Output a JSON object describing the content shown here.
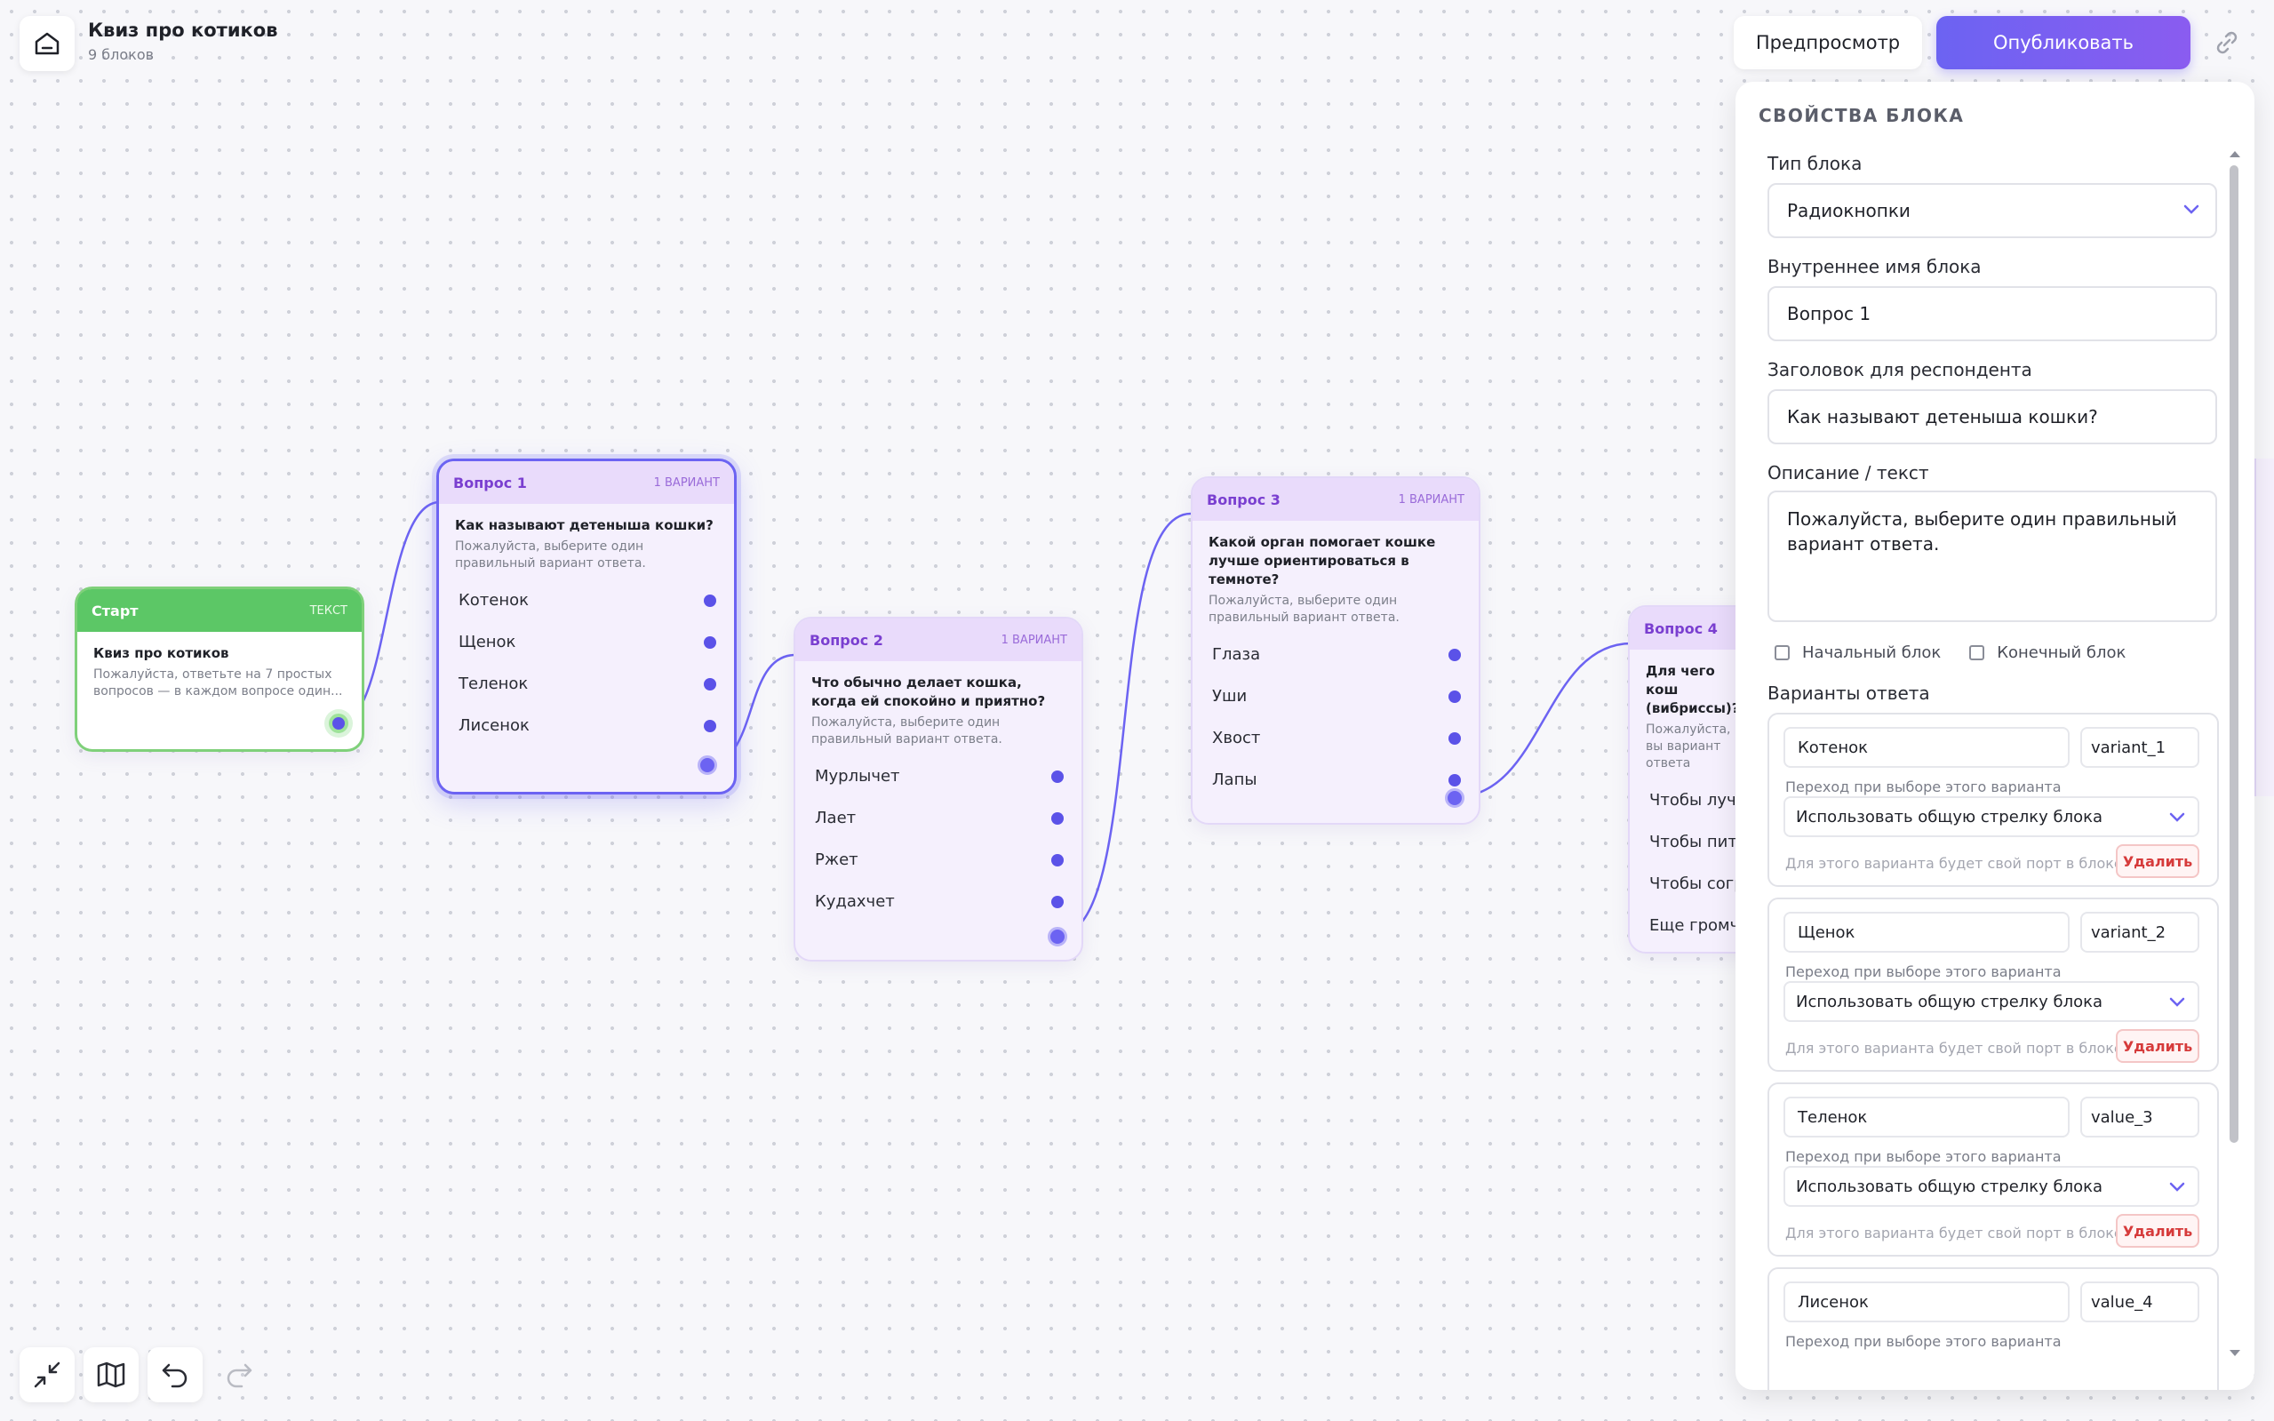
{
  "header": {
    "title": "Квиз про котиков",
    "subtitle": "9 блоков",
    "preview_label": "Предпросмотр",
    "publish_label": "Опубликовать"
  },
  "colors": {
    "accent": "#6c63f2",
    "start": "#5cc766",
    "node_header": "#e9dbfb",
    "delete": "#d63b3b"
  },
  "nodes": {
    "start": {
      "name": "Старт",
      "type": "ТЕКСТ",
      "question": "Квиз про котиков",
      "desc": "Пожалуйста, ответьте на 7 простых вопросов — в каждом вопросе один..."
    },
    "q1": {
      "name": "Вопрос 1",
      "count": "1 ВАРИАНТ",
      "question": "Как называют детеныша кошки?",
      "desc": "Пожалуйста, выберите один правильный вариант ответа.",
      "options": [
        "Котенок",
        "Щенок",
        "Теленок",
        "Лисенок"
      ]
    },
    "q2": {
      "name": "Вопрос 2",
      "count": "1 ВАРИАНТ",
      "question": "Что обычно делает кошка, когда ей спокойно и приятно?",
      "desc": "Пожалуйста, выберите один правильный вариант ответа.",
      "options": [
        "Мурлычет",
        "Лает",
        "Ржет",
        "Кудахчет"
      ]
    },
    "q3": {
      "name": "Вопрос 3",
      "count": "1 ВАРИАНТ",
      "question": "Какой орган помогает кошке лучше ориентироваться в темноте?",
      "desc": "Пожалуйста, выберите один правильный вариант ответа.",
      "options": [
        "Глаза",
        "Уши",
        "Хвост",
        "Лапы"
      ]
    },
    "q4": {
      "name": "Вопрос 4",
      "question": "Для чего кош (вибриссы)?",
      "desc": "Пожалуйста, вы вариант ответа",
      "options": [
        "Чтобы лучш",
        "Чтобы пить",
        "Чтобы согре",
        "Еще громче"
      ]
    }
  },
  "panel": {
    "title": "СВОЙСТВА БЛОКА",
    "type_label": "Тип блока",
    "type_value": "Радиокнопки",
    "internal_label": "Внутреннее имя блока",
    "internal_value": "Вопрос 1",
    "heading_label": "Заголовок для респондента",
    "heading_value": "Как называют детеныша кошки?",
    "desc_label": "Описание / текст",
    "desc_value": "Пожалуйста, выберите один правильный вариант ответа.",
    "start_block": "Начальный блок",
    "end_block": "Конечный блок",
    "variants_label": "Варианты ответа",
    "transition_label": "Переход при выборе этого варианта",
    "transition_value": "Использовать общую стрелку блока",
    "port_hint": "Для этого варианта будет свой порт в блоке",
    "delete_label": "Удалить",
    "variants": [
      {
        "label": "Котенок",
        "value": "variant_1"
      },
      {
        "label": "Щенок",
        "value": "variant_2"
      },
      {
        "label": "Теленок",
        "value": "value_3"
      },
      {
        "label": "Лисенок",
        "value": "value_4"
      }
    ]
  }
}
